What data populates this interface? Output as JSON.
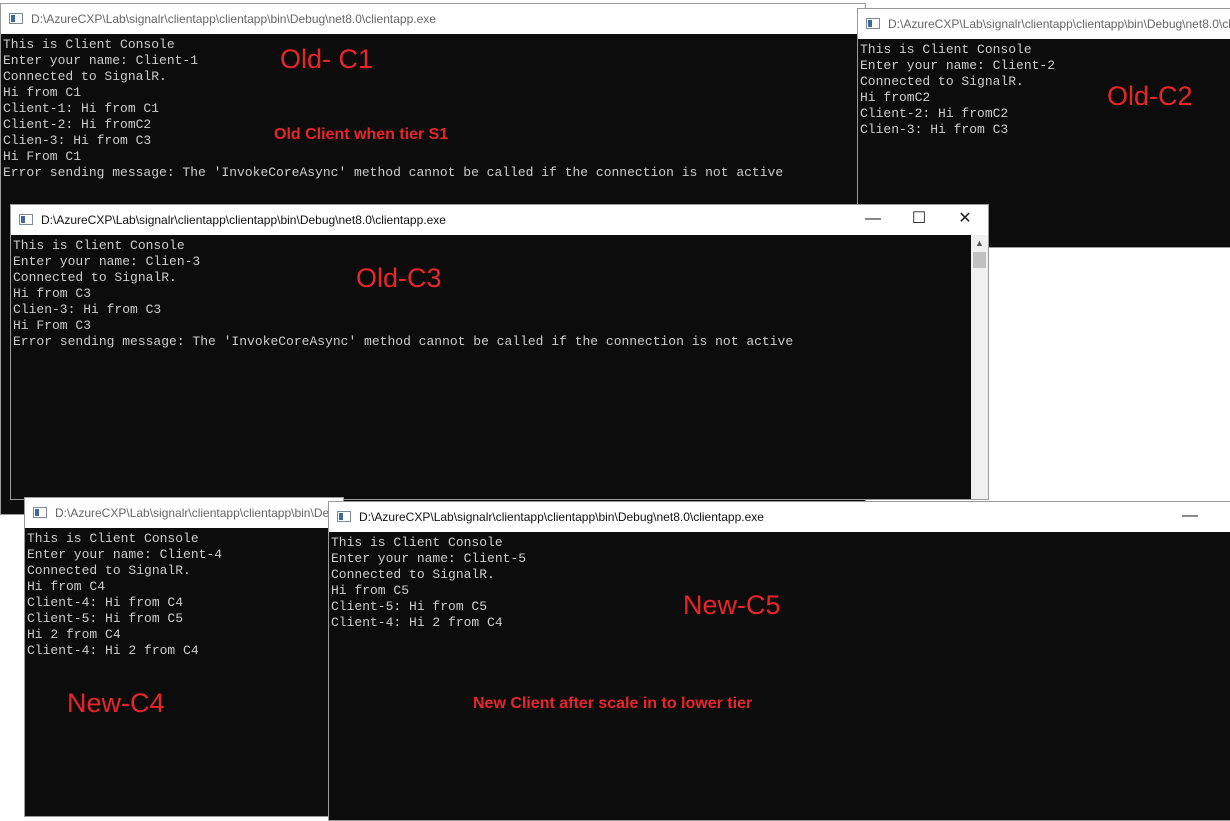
{
  "common": {
    "title": "D:\\AzureCXP\\Lab\\signalr\\clientapp\\clientapp\\bin\\Debug\\net8.0\\clientapp.exe",
    "minimize": "—",
    "maximize": "☐",
    "close": "✕",
    "scroll_up": "▲"
  },
  "c1": {
    "lines": [
      "This is Client Console",
      "Enter your name: Client-1",
      "Connected to SignalR.",
      "Hi from C1",
      "Client-1: Hi from C1",
      "Client-2: Hi fromC2",
      "Clien-3: Hi from C3",
      "Hi From C1",
      "Error sending message: The 'InvokeCoreAsync' method cannot be called if the connection is not active"
    ],
    "label": "Old- C1",
    "note": "Old Client when tier S1"
  },
  "c2": {
    "lines": [
      "This is Client Console",
      "Enter your name: Client-2",
      "Connected to SignalR.",
      "Hi fromC2",
      "Client-2: Hi fromC2",
      "Clien-3: Hi from C3"
    ],
    "label": "Old-C2"
  },
  "c3": {
    "lines": [
      "This is Client Console",
      "Enter your name: Clien-3",
      "Connected to SignalR.",
      "Hi from C3",
      "Clien-3: Hi from C3",
      "Hi From C3",
      "Error sending message: The 'InvokeCoreAsync' method cannot be called if the connection is not active"
    ],
    "label": "Old-C3"
  },
  "c4": {
    "lines": [
      "This is Client Console",
      "Enter your name: Client-4",
      "Connected to SignalR.",
      "Hi from C4",
      "Client-4: Hi from C4",
      "Client-5: Hi from C5",
      "Hi 2 from C4",
      "Client-4: Hi 2 from C4"
    ],
    "label": "New-C4"
  },
  "c5": {
    "lines": [
      "This is Client Console",
      "Enter your name: Client-5",
      "Connected to SignalR.",
      "Hi from C5",
      "Client-5: Hi from C5",
      "Client-4: Hi 2 from C4"
    ],
    "label": "New-C5",
    "note": "New Client after scale in to lower tier"
  }
}
